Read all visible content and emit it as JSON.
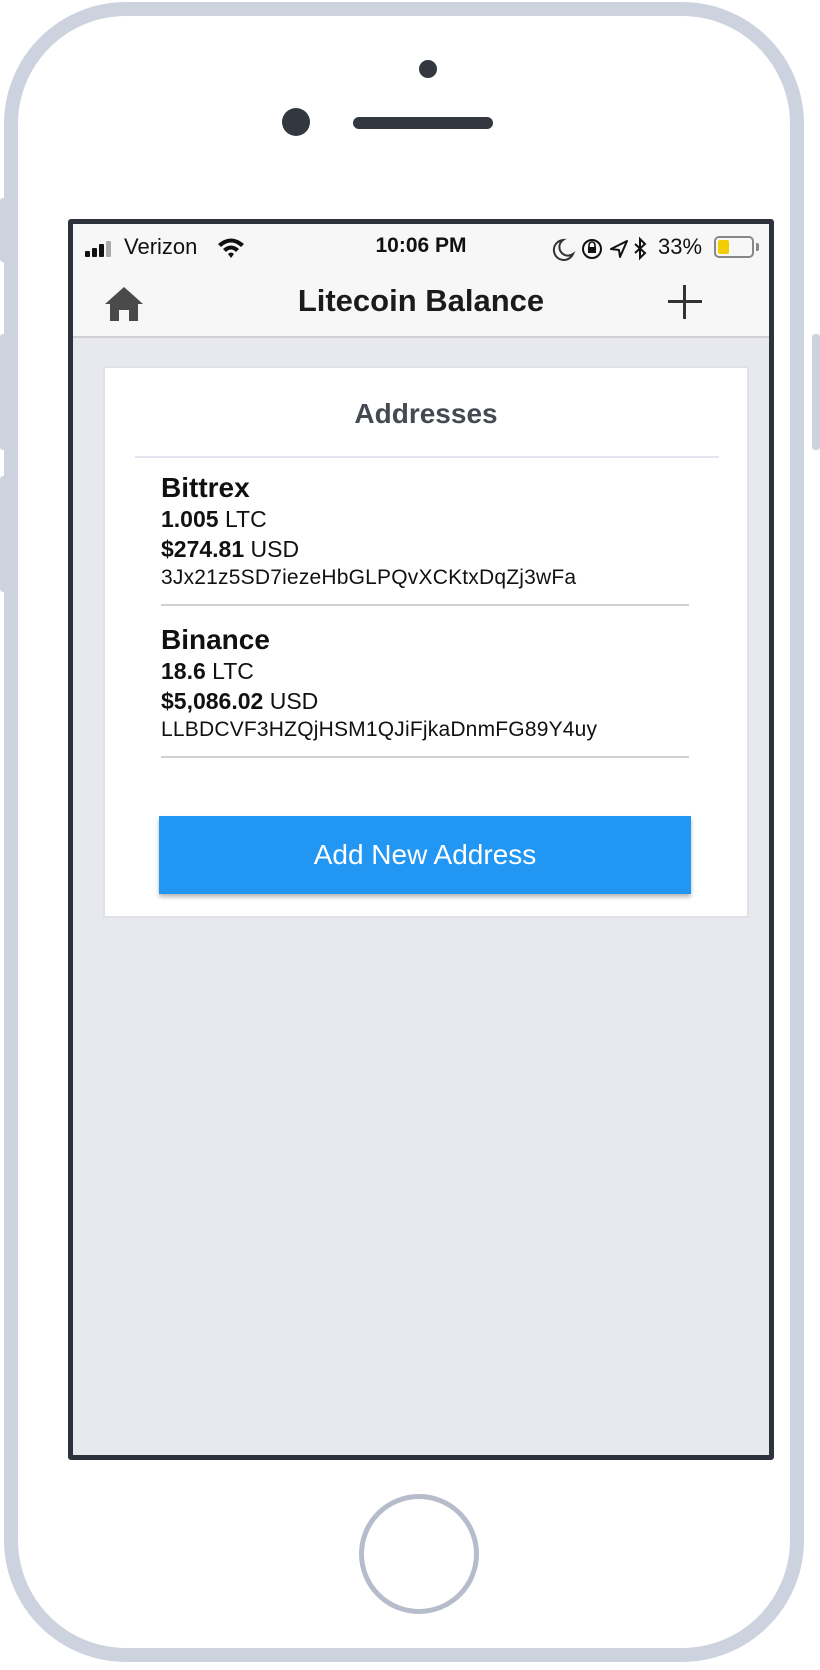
{
  "status_bar": {
    "carrier": "Verizon",
    "time": "10:06 PM",
    "battery_percent": "33%",
    "battery_level": 0.33,
    "icons": [
      "signal-icon",
      "wifi-icon",
      "moon-icon",
      "orientation-lock-icon",
      "location-arrow-icon",
      "bluetooth-icon",
      "battery-icon"
    ]
  },
  "nav": {
    "title": "Litecoin Balance",
    "left_icon": "home-icon",
    "right_icon": "plus-icon"
  },
  "card": {
    "title": "Addresses",
    "addresses": [
      {
        "name": "Bittrex",
        "ltc_amount": "1.005",
        "ltc_unit": "LTC",
        "usd_amount": "$274.81",
        "usd_unit": "USD",
        "address": "3Jx21z5SD7iezeHbGLPQvXCKtxDqZj3wFa"
      },
      {
        "name": "Binance",
        "ltc_amount": "18.6",
        "ltc_unit": "LTC",
        "usd_amount": "$5,086.02",
        "usd_unit": "USD",
        "address": "LLBDCVF3HZQjHSM1QJiFjkaDnmFG89Y4uy"
      }
    ],
    "add_button_label": "Add New Address"
  },
  "colors": {
    "accent": "#2196f3",
    "background": "#e8e8ef",
    "battery": "#f4cd00"
  }
}
